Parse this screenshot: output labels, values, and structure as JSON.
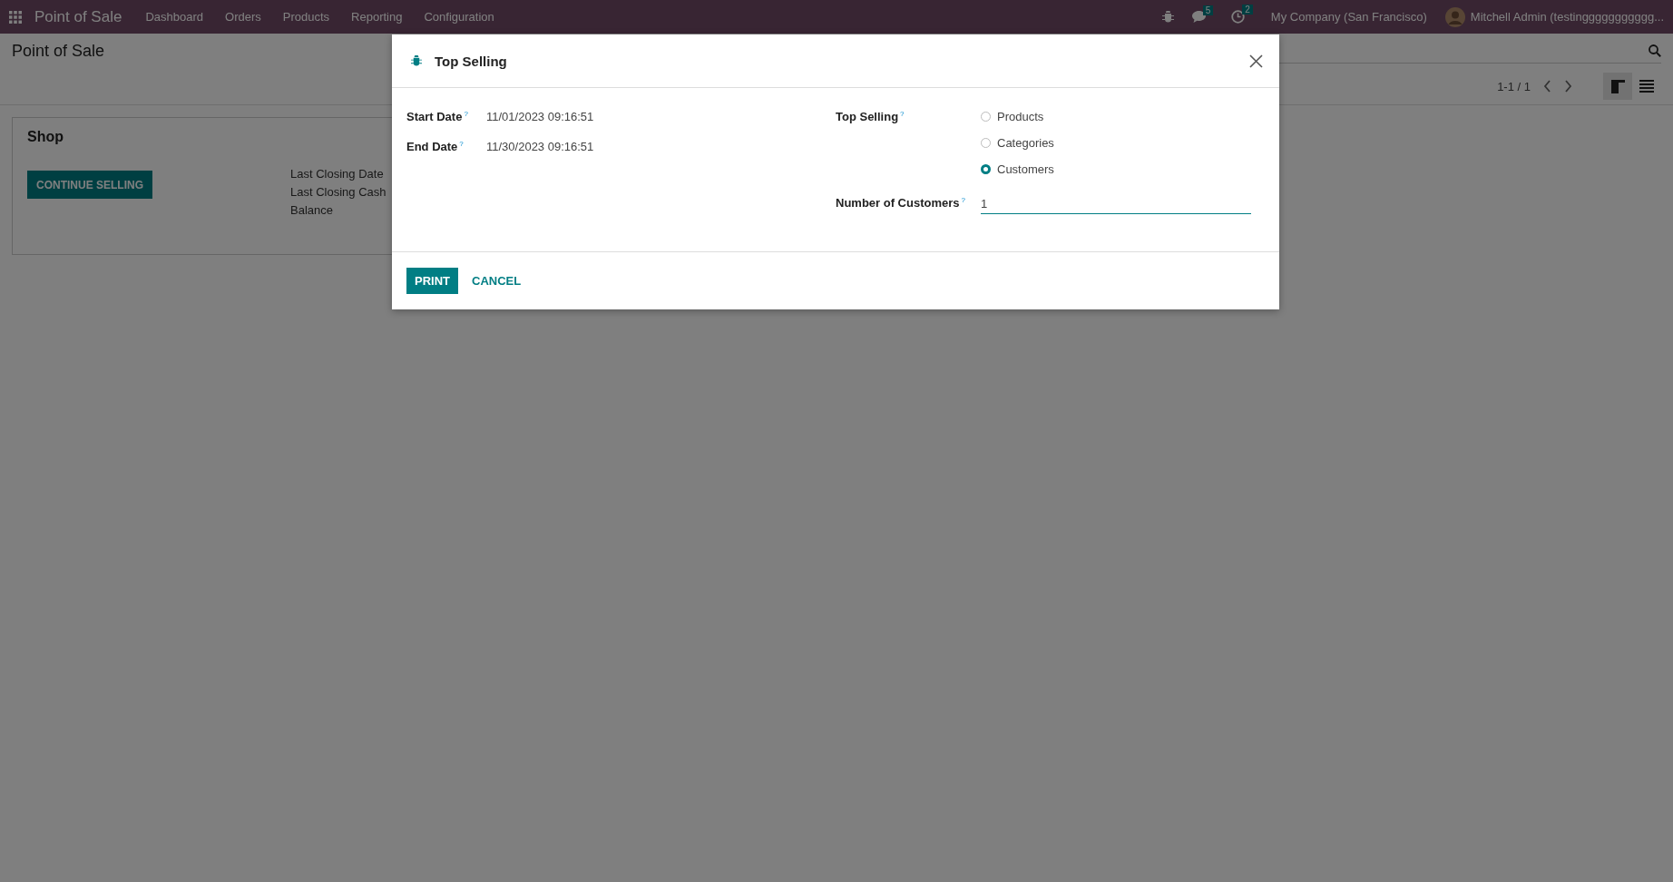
{
  "navbar": {
    "app_name": "Point of Sale",
    "menu": [
      "Dashboard",
      "Orders",
      "Products",
      "Reporting",
      "Configuration"
    ],
    "messages_count": "5",
    "activities_count": "2",
    "company": "My Company (San Francisco)",
    "user": "Mitchell Admin (testinggggggggggg..."
  },
  "breadcrumb": "Point of Sale",
  "pager": "1-1 / 1",
  "views": [
    {
      "kind": "kanban",
      "selected": true
    },
    {
      "kind": "list",
      "selected": false
    }
  ],
  "card": {
    "title": "Shop",
    "button": "CONTINUE SELLING",
    "info": [
      "Last Closing Date",
      "Last Closing Cash",
      "Balance"
    ]
  },
  "dialog": {
    "title": "Top Selling",
    "fields": [
      {
        "label": "Start Date",
        "help": "?",
        "value": "11/01/2023 09:16:51"
      },
      {
        "label": "End Date",
        "help": "?",
        "value": "11/30/2023 09:16:51"
      }
    ],
    "top_selling": {
      "label": "Top Selling",
      "help": "?",
      "options": [
        {
          "label": "Products",
          "selected": false
        },
        {
          "label": "Categories",
          "selected": false
        },
        {
          "label": "Customers",
          "selected": true
        }
      ]
    },
    "count": {
      "label": "Number of Customers",
      "help": "?",
      "value": "1"
    },
    "buttons": [
      {
        "label": "PRINT",
        "kind": "primary"
      },
      {
        "label": "CANCEL",
        "kind": "link"
      }
    ]
  }
}
